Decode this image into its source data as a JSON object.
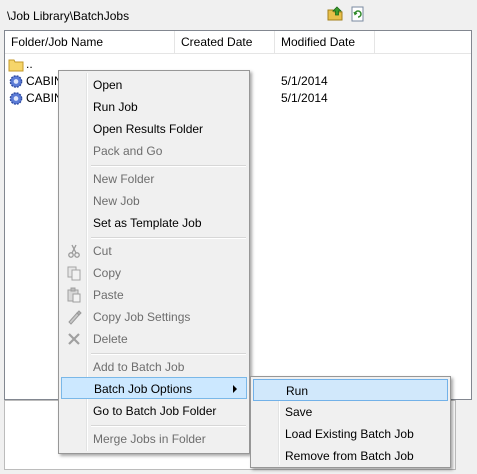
{
  "path": "\\Job Library\\BatchJobs",
  "toolbar": {
    "up_icon": "folder-up-icon",
    "refresh_icon": "refresh-icon"
  },
  "columns": {
    "name": "Folder/Job Name",
    "created": "Created Date",
    "modified": "Modified Date"
  },
  "rows": [
    {
      "name": "..",
      "modified": ""
    },
    {
      "name": "CABIN",
      "modified": "5/1/2014"
    },
    {
      "name": "CABIN",
      "modified": "5/1/2014"
    }
  ],
  "menu": {
    "open": "Open",
    "run_job": "Run Job",
    "open_results_folder": "Open Results Folder",
    "pack_and_go": "Pack and Go",
    "new_folder": "New Folder",
    "new_job": "New Job",
    "set_as_template_job": "Set as Template Job",
    "cut": "Cut",
    "copy": "Copy",
    "paste": "Paste",
    "copy_job_settings": "Copy Job Settings",
    "delete": "Delete",
    "add_to_batch_job": "Add to Batch Job",
    "batch_job_options": "Batch Job Options",
    "go_to_batch_job_folder": "Go to Batch Job Folder",
    "merge_jobs_in_folder": "Merge Jobs in Folder"
  },
  "submenu": {
    "run": "Run",
    "save": "Save",
    "load_existing_batch_job": "Load Existing Batch Job",
    "remove_from_batch_job": "Remove from Batch Job"
  },
  "colors": {
    "highlight": "#cce8ff",
    "highlight_border": "#7ab8e8",
    "disabled_text": "#6d6d6d"
  }
}
